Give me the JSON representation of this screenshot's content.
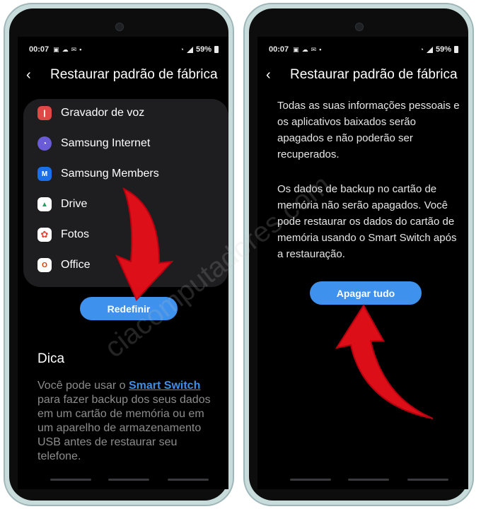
{
  "status": {
    "time": "00:07",
    "notif_icons": [
      "image-icon",
      "cloud-icon",
      "mail-icon",
      "dot-icon"
    ],
    "battery": "59%"
  },
  "left": {
    "title": "Restaurar padrão de fábrica",
    "apps": [
      {
        "name": "Gravador de voz",
        "icon": "recorder-icon",
        "color": "#e04848",
        "glyph": "❙"
      },
      {
        "name": "Samsung Internet",
        "icon": "samsung-internet-icon",
        "color": "#6a5bd6",
        "glyph": "◔"
      },
      {
        "name": "Samsung Members",
        "icon": "samsung-members-icon",
        "color": "#1b6fe8",
        "glyph": "M"
      },
      {
        "name": "Drive",
        "icon": "drive-icon",
        "color": "#ffffff",
        "glyph": "▲"
      },
      {
        "name": "Fotos",
        "icon": "photos-icon",
        "color": "#ffffff",
        "glyph": "✿"
      },
      {
        "name": "Office",
        "icon": "office-icon",
        "color": "#ffffff",
        "glyph": "O"
      }
    ],
    "button": "Redefinir",
    "dica_title": "Dica",
    "tip": {
      "before": "Você pode usar o ",
      "link": "Smart Switch",
      "after": " para fazer backup dos seus dados em um cartão de memória ou em um aparelho de armazenamento USB antes de restaurar seu telefone."
    }
  },
  "right": {
    "title": "Restaurar padrão de fábrica",
    "warning1": "Todas as suas informações pessoais e os aplicativos baixados serão apagados e não poderão ser recuperados.",
    "warning2": "Os dados de backup no cartão de memória não serão apagados. Você pode restaurar os dados do cartão de memória usando o Smart Switch após a restauração.",
    "button": "Apagar tudo"
  },
  "watermark": "ciacomputadores.com",
  "colors": {
    "accent": "#3e91ec",
    "annotation_arrow": "#e8101a",
    "phone_frame": "#c9dcdc"
  }
}
